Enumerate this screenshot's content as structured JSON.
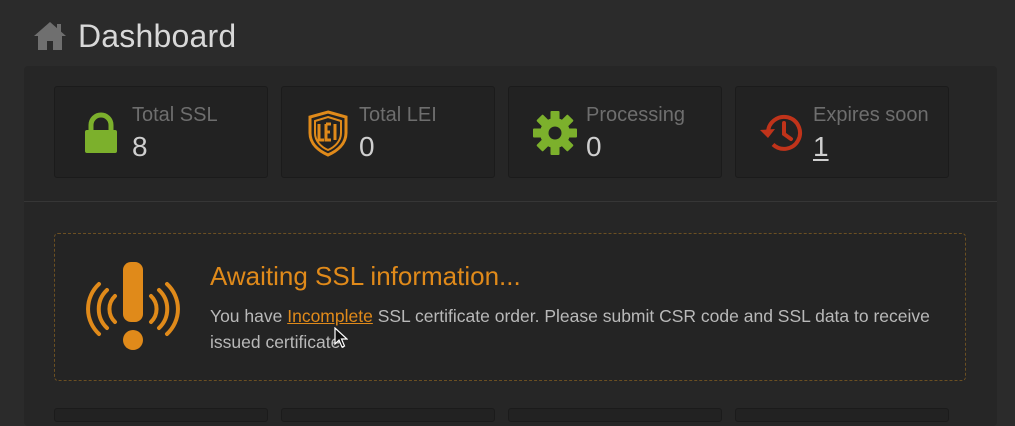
{
  "header": {
    "title": "Dashboard",
    "icon": "home-icon"
  },
  "stats": [
    {
      "label": "Total SSL",
      "value": "8",
      "icon": "lock-icon",
      "color": "#7cb02c"
    },
    {
      "label": "Total LEI",
      "value": "0",
      "icon": "lei-shield-icon",
      "color": "#e08a1a"
    },
    {
      "label": "Processing",
      "value": "0",
      "icon": "gear-icon",
      "color": "#7cb02c"
    },
    {
      "label": "Expires soon",
      "value": "1",
      "icon": "history-clock-icon",
      "color": "#c0331a"
    }
  ],
  "alert": {
    "title": "Awaiting SSL information...",
    "text_before": "You have ",
    "link": "Incomplete",
    "text_after": " SSL certificate order. Please submit CSR code and SSL data to receive issued certificate.",
    "icon": "alert-broadcast-icon",
    "accent": "#e08a1a"
  },
  "colors": {
    "background": "#2b2b2b",
    "panel": "#262626",
    "card": "#222222"
  }
}
